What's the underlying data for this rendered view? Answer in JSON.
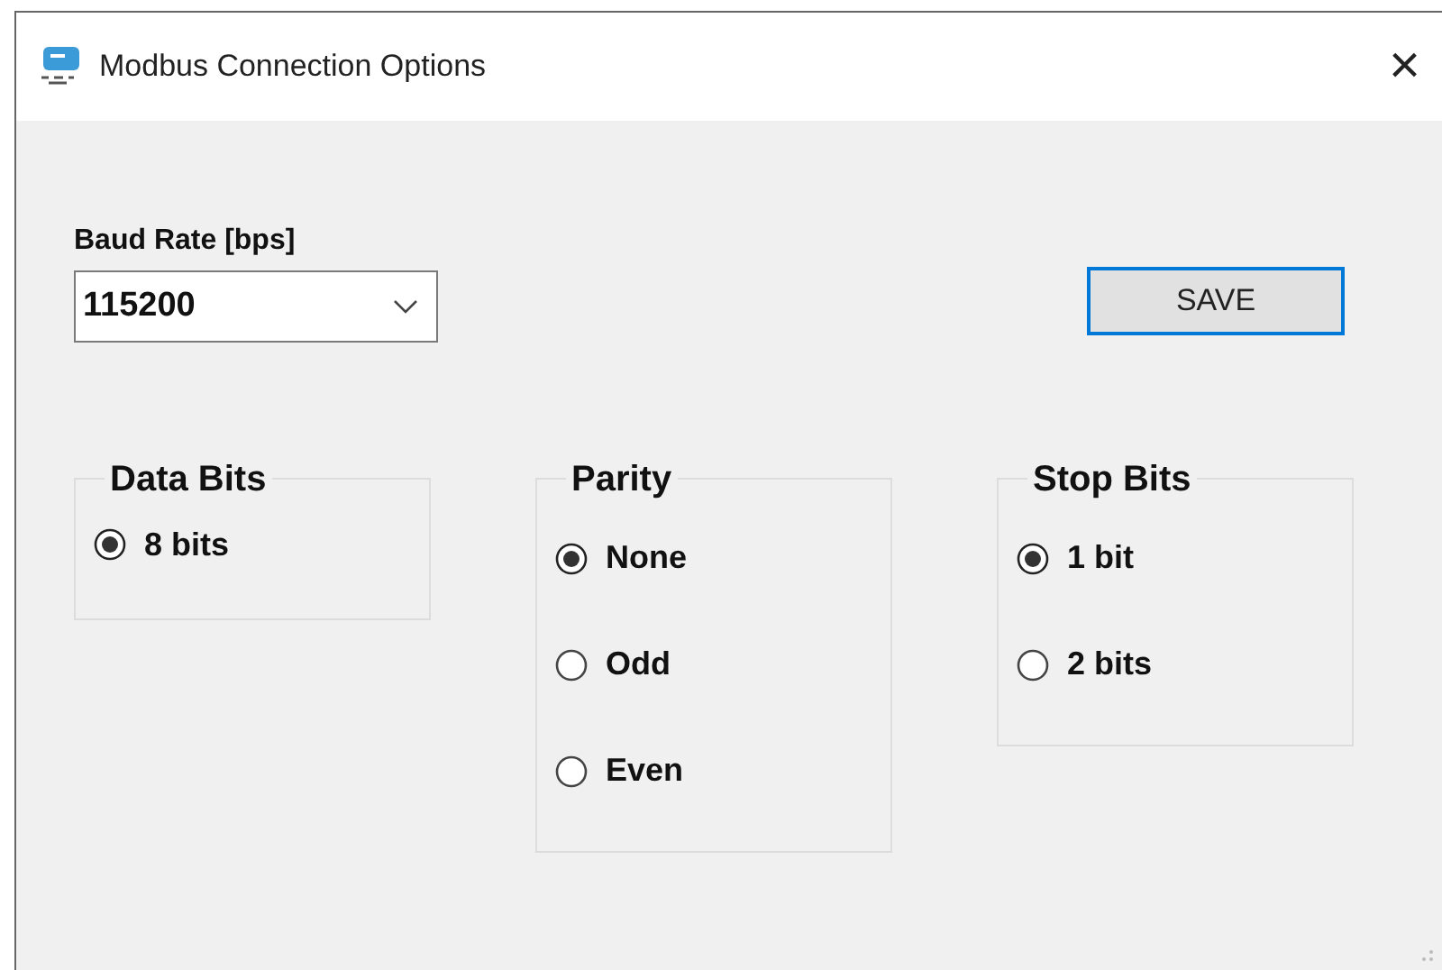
{
  "window": {
    "title": "Modbus Connection Options",
    "close": "×"
  },
  "baud_rate": {
    "label": "Baud Rate [bps]",
    "value": "115200"
  },
  "save_button": "SAVE",
  "groups": [
    {
      "title": "Data Bits",
      "options": [
        {
          "label": "8 bits",
          "selected": true
        }
      ]
    },
    {
      "title": "Parity",
      "options": [
        {
          "label": "None",
          "selected": true
        },
        {
          "label": "Odd",
          "selected": false
        },
        {
          "label": "Even",
          "selected": false
        }
      ]
    },
    {
      "title": "Stop Bits",
      "options": [
        {
          "label": "1 bit",
          "selected": true
        },
        {
          "label": "2 bits",
          "selected": false
        }
      ]
    }
  ]
}
